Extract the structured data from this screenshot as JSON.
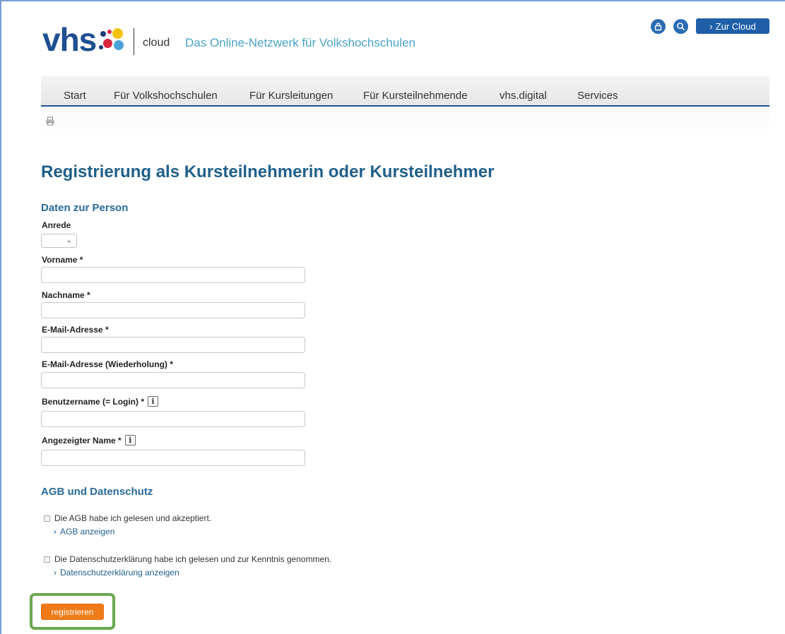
{
  "header": {
    "logo_text": "vhs",
    "cloud_label": "cloud",
    "tagline": "Das Online-Netzwerk für Volkshochschulen",
    "lock_icon": "lock-icon",
    "search_icon": "search-icon",
    "cloud_button_label": "Zur Cloud"
  },
  "nav": {
    "items": [
      "Start",
      "Für Volkshochschulen",
      "Für Kursleitungen",
      "Für Kursteilnehmende",
      "vhs.digital",
      "Services"
    ],
    "print_icon": "print-icon"
  },
  "main": {
    "title": "Registrierung als Kursteilnehmerin oder Kursteilnehmer",
    "person_section": {
      "heading": "Daten zur Person",
      "salutation_label": "Anrede",
      "salutation_value": "",
      "fields": [
        {
          "label": "Vorname *",
          "value": ""
        },
        {
          "label": "Nachname *",
          "value": ""
        },
        {
          "label": "E-Mail-Adresse *",
          "value": ""
        },
        {
          "label": "E-Mail-Adresse (Wiederholung) *",
          "value": ""
        },
        {
          "label": "Benutzername (= Login) *",
          "value": ""
        },
        {
          "label": "Angezeigter Name *",
          "value": ""
        }
      ],
      "info_glyph": "i"
    },
    "terms_section": {
      "heading": "AGB und Datenschutz",
      "agb_label": "Die AGB habe ich gelesen und akzeptiert.",
      "agb_link": "AGB anzeigen",
      "privacy_label": "Die Datenschutzerklärung habe ich gelesen und zur Kenntnis genommen.",
      "privacy_link": "Datenschutzerklärung anzeigen"
    },
    "submit_label": "registrieren"
  },
  "colors": {
    "brand_blue": "#1d4f91",
    "title_blue": "#1f5f8b",
    "submit_orange": "#f07a17",
    "highlight_green": "#6aa84f"
  }
}
